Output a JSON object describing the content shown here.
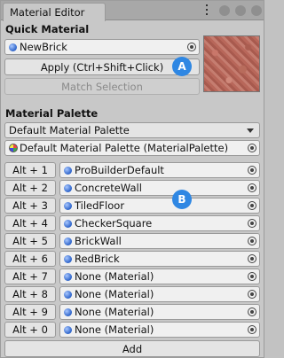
{
  "window": {
    "tab_title": "Material Editor"
  },
  "quick_material": {
    "heading": "Quick Material",
    "material": "NewBrick",
    "apply_label": "Apply (Ctrl+Shift+Click)",
    "match_label": "Match Selection"
  },
  "palette": {
    "heading": "Material Palette",
    "dropdown_value": "Default Material Palette",
    "asset_field": "Default Material Palette (MaterialPalette)"
  },
  "rows": [
    {
      "shortcut": "Alt + 1",
      "material": "ProBuilderDefault"
    },
    {
      "shortcut": "Alt + 2",
      "material": "ConcreteWall"
    },
    {
      "shortcut": "Alt + 3",
      "material": "TiledFloor"
    },
    {
      "shortcut": "Alt + 4",
      "material": "CheckerSquare"
    },
    {
      "shortcut": "Alt + 5",
      "material": "BrickWall"
    },
    {
      "shortcut": "Alt + 6",
      "material": "RedBrick"
    },
    {
      "shortcut": "Alt + 7",
      "material": "None (Material)"
    },
    {
      "shortcut": "Alt + 8",
      "material": "None (Material)"
    },
    {
      "shortcut": "Alt + 9",
      "material": "None (Material)"
    },
    {
      "shortcut": "Alt + 0",
      "material": "None (Material)"
    }
  ],
  "add_label": "Add",
  "callouts": {
    "a": "A",
    "b": "B"
  },
  "colors": {
    "callout": "#2f87e3",
    "material_dot": "#2b62c9"
  }
}
